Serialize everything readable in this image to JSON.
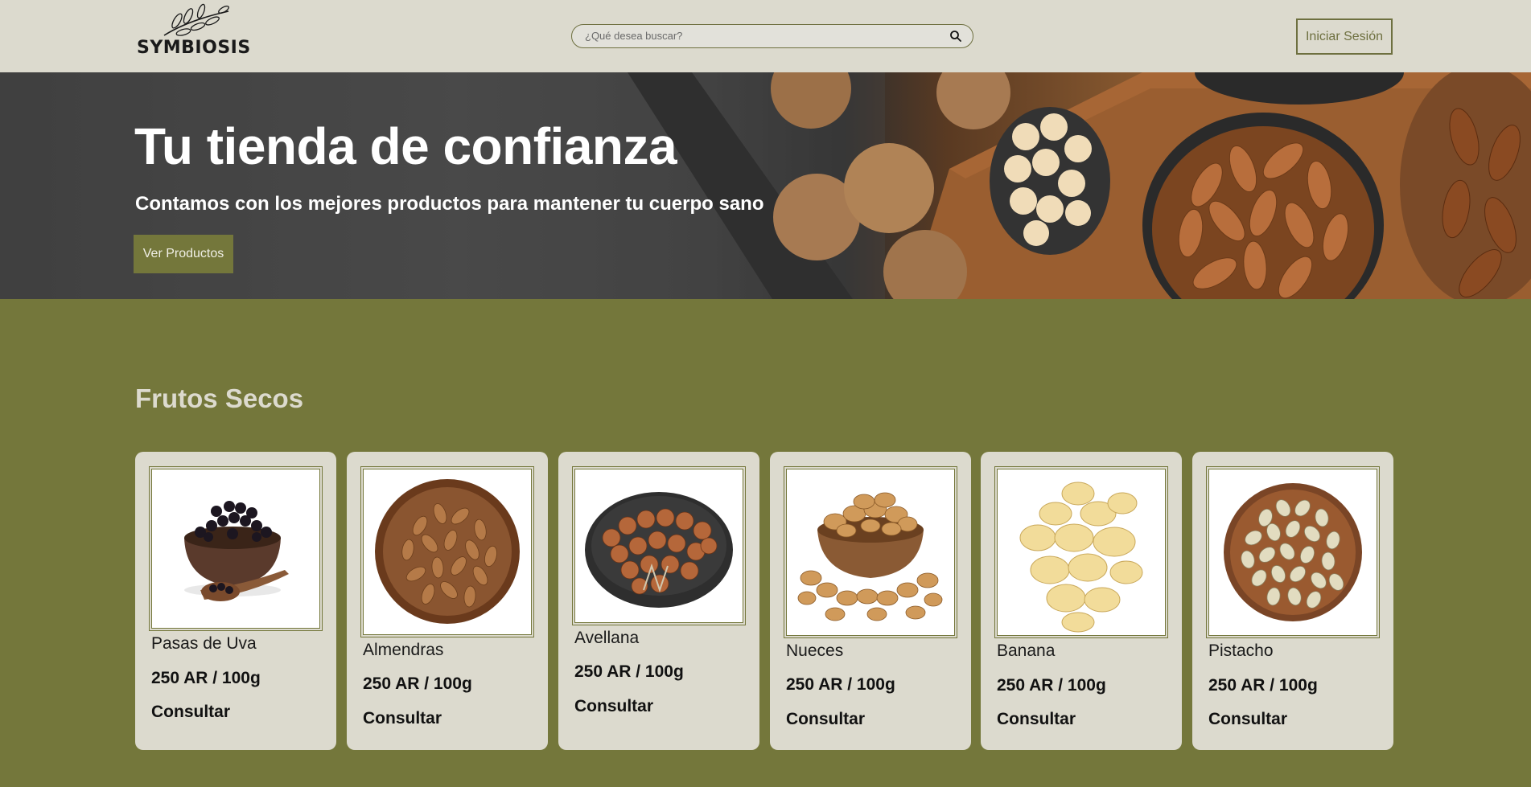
{
  "header": {
    "logo_text": "SYMBIOSIS",
    "search_placeholder": "¿Qué desea buscar?",
    "login_label": "Iniciar Sesión"
  },
  "hero": {
    "title": "Tu tienda de confianza",
    "subtitle": "Contamos con los mejores productos para mantener tu cuerpo sano",
    "cta_label": "Ver Productos"
  },
  "section": {
    "title": "Frutos Secos"
  },
  "products": [
    {
      "name": "Pasas de Uva",
      "price": "250 AR / 100g",
      "action": "Consultar"
    },
    {
      "name": "Almendras",
      "price": "250 AR / 100g",
      "action": "Consultar"
    },
    {
      "name": "Avellana",
      "price": "250 AR / 100g",
      "action": "Consultar"
    },
    {
      "name": "Nueces",
      "price": "250 AR / 100g",
      "action": "Consultar"
    },
    {
      "name": "Banana",
      "price": "250 AR / 100g",
      "action": "Consultar"
    },
    {
      "name": "Pistacho",
      "price": "250 AR / 100g",
      "action": "Consultar"
    }
  ],
  "colors": {
    "header_bg": "#dcdace",
    "page_bg": "#74773b",
    "accent": "#6e7040",
    "card_bg": "#dcdace"
  },
  "icons": {
    "search": "search-icon",
    "logo": "olive-branch-icon"
  }
}
